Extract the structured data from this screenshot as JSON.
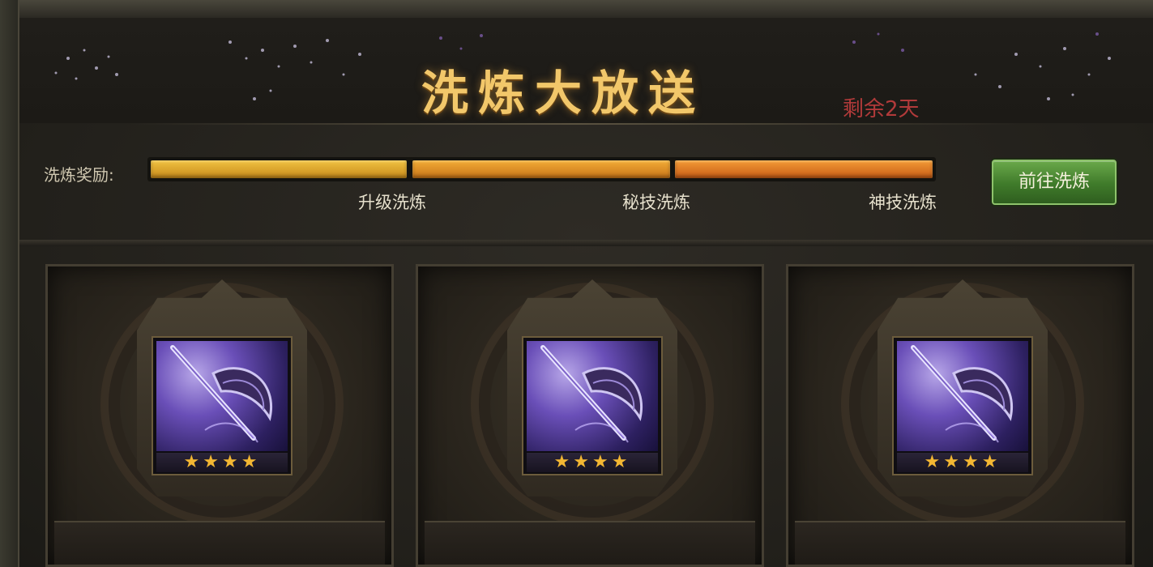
{
  "banner": {
    "title": "洗炼大放送",
    "remaining": "剩余2天"
  },
  "rewards": {
    "label": "洗炼奖励:",
    "progress_segments": [
      {
        "color": "#e0a82a",
        "fill": 1.0
      },
      {
        "color": "#e68a26",
        "fill": 1.0
      },
      {
        "color": "#e6762a",
        "fill": 1.0
      }
    ],
    "milestones": [
      "升级洗炼",
      "秘技洗炼",
      "神技洗炼"
    ],
    "go_button": "前往洗炼"
  },
  "items": [
    {
      "icon": "purple-axe-weapon-icon",
      "stars": 4,
      "stars_text": "★★★★"
    },
    {
      "icon": "purple-axe-weapon-icon",
      "stars": 4,
      "stars_text": "★★★★"
    },
    {
      "icon": "purple-axe-weapon-icon",
      "stars": 4,
      "stars_text": "★★★★"
    }
  ],
  "colors": {
    "title": "#f2c76a",
    "remaining": "#b13a3a",
    "button": "#3f7a2a",
    "star": "#f3b733"
  }
}
